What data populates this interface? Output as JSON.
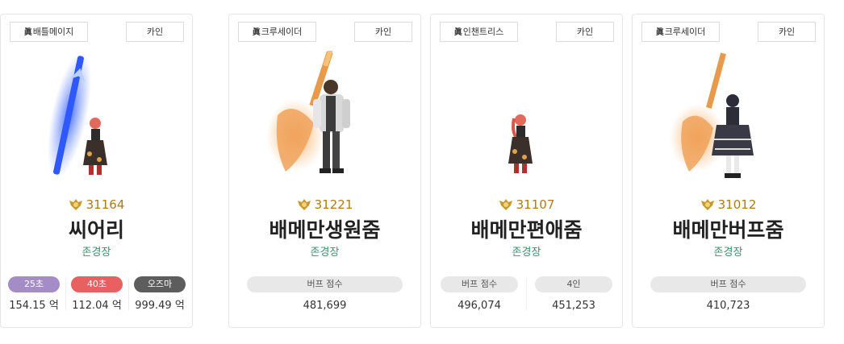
{
  "cards": [
    {
      "job_mark": "眞",
      "job": "크루세이더",
      "server": "카인",
      "fame": "31221",
      "name": "배메만생원줌",
      "guild": "존경장",
      "stats": [
        {
          "label": "버프 점수",
          "value": "481,699"
        }
      ]
    },
    {
      "job_mark": "眞",
      "job": "인챈트리스",
      "server": "카인",
      "fame": "31107",
      "name": "배메만편애줌",
      "guild": "존경장",
      "stats": [
        {
          "label": "버프 점수",
          "value": "496,074"
        },
        {
          "label": "4인",
          "value": "451,253"
        }
      ]
    },
    {
      "job_mark": "眞",
      "job": "크루세이더",
      "server": "카인",
      "fame": "31012",
      "name": "배메만버프줌",
      "guild": "존경장",
      "stats": [
        {
          "label": "버프 점수",
          "value": "410,723"
        }
      ]
    },
    {
      "job_mark": "眞",
      "job": "배틀메이지",
      "server": "카인",
      "fame": "31164",
      "name": "씨어리",
      "guild": "존경장",
      "stats": [
        {
          "label": "25초",
          "value": "154.15 억",
          "color": "#a48cc7"
        },
        {
          "label": "40초",
          "value": "112.04 억",
          "color": "#e86060"
        },
        {
          "label": "오즈마",
          "value": "999.49 억",
          "color": "#5d5d5d"
        }
      ]
    }
  ]
}
